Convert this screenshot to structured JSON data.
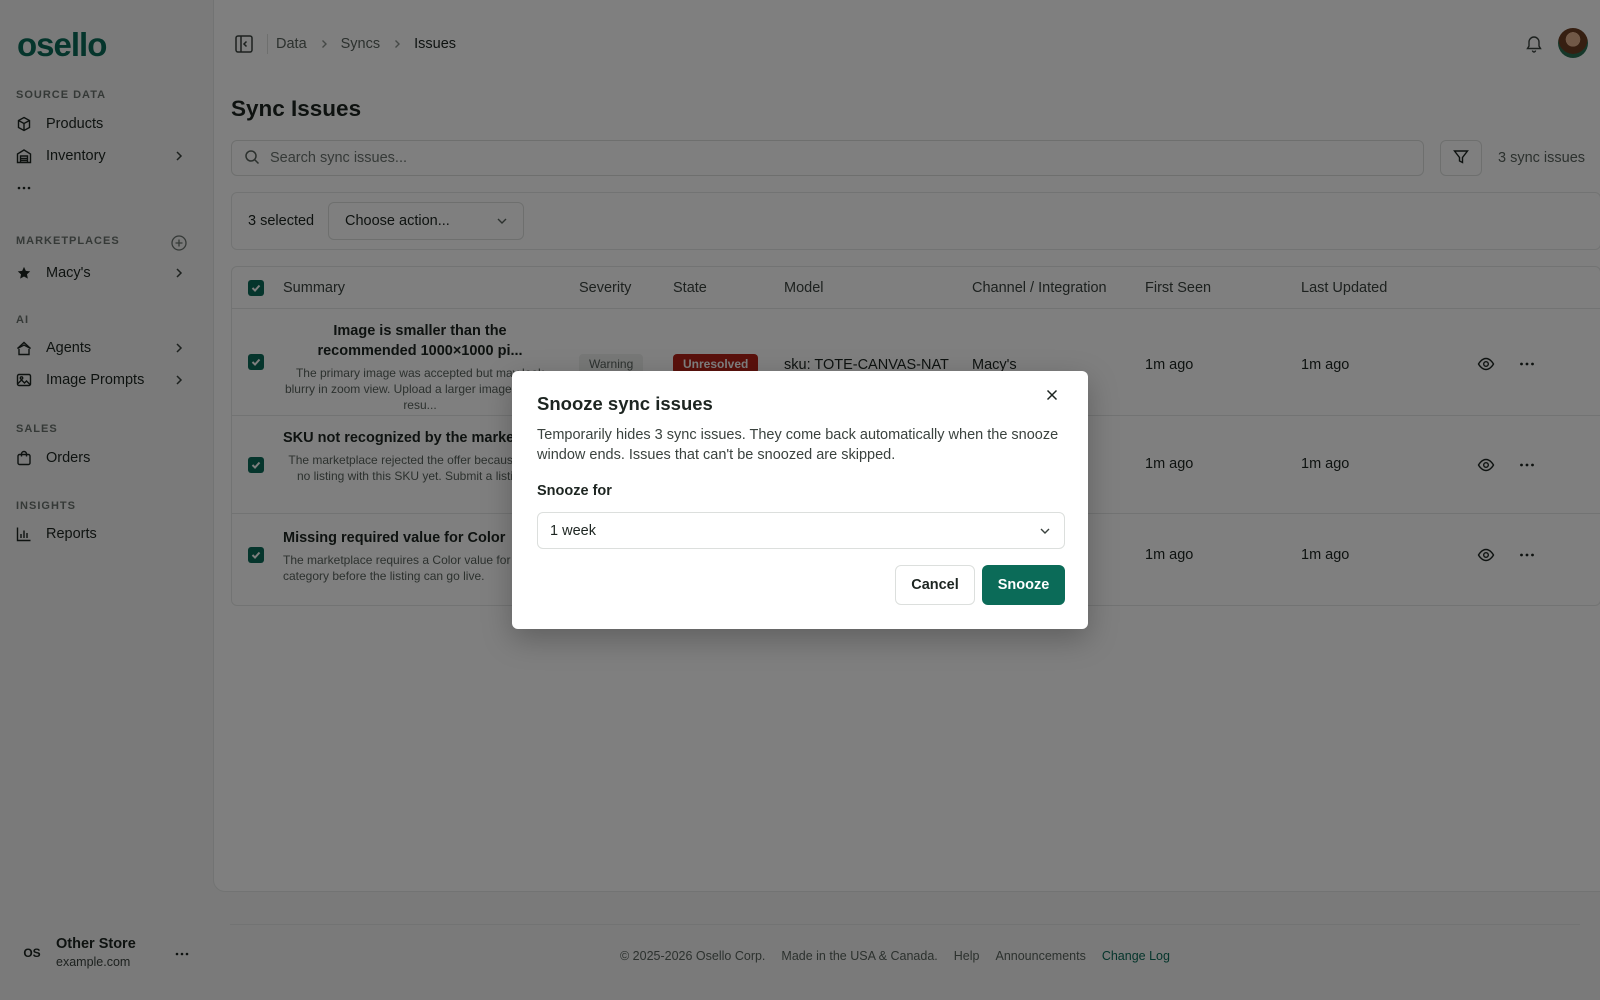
{
  "brand": {
    "logo": "osello",
    "accent": "#0b6b58"
  },
  "sidebar": {
    "sections": [
      {
        "label": "SOURCE DATA",
        "items": [
          {
            "label": "Products",
            "icon": "box-icon"
          },
          {
            "label": "Inventory",
            "icon": "warehouse-icon",
            "chevron": true
          }
        ]
      },
      {
        "label": "MARKETPLACES",
        "items": [
          {
            "label": "Macy's",
            "icon": "star-icon",
            "chevron": true
          }
        ]
      },
      {
        "label": "AI",
        "items": [
          {
            "label": "Agents",
            "icon": "agent-icon",
            "chevron": true
          },
          {
            "label": "Image Prompts",
            "icon": "image-icon",
            "chevron": true
          }
        ]
      },
      {
        "label": "SALES",
        "items": [
          {
            "label": "Orders",
            "icon": "bag-icon"
          }
        ]
      },
      {
        "label": "INSIGHTS",
        "items": [
          {
            "label": "Reports",
            "icon": "chart-icon"
          }
        ]
      }
    ],
    "store": {
      "initials": "OS",
      "name": "Other Store",
      "url": "example.com"
    }
  },
  "breadcrumb": [
    "Data",
    "Syncs",
    "Issues"
  ],
  "page": {
    "title": "Sync Issues",
    "search_placeholder": "Search sync issues...",
    "count": "3 sync issues",
    "selected": "3 selected",
    "bulk_action_placeholder": "Choose action..."
  },
  "table": {
    "columns": [
      "Summary",
      "Severity",
      "State",
      "Model",
      "Channel / Integration",
      "First Seen",
      "Last Updated"
    ],
    "rows": [
      {
        "title": "Image is smaller than the recommended 1000×1000 pi...",
        "desc": "The primary image was accepted but may look blurry in zoom view. Upload a larger image for best resu...",
        "severity": "Warning",
        "state": "Unresolved",
        "model": "sku: TOTE-CANVAS-NAT",
        "channel": "Macy's",
        "first_seen": "1m ago",
        "last_updated": "1m ago"
      },
      {
        "title": "SKU not recognized by the marketplace",
        "desc": "The marketplace rejected the offer because it has no listing with this SKU yet. Submit a listing f...",
        "severity": "",
        "state": "",
        "model": "",
        "channel": "",
        "first_seen": "1m ago",
        "last_updated": "1m ago"
      },
      {
        "title": "Missing required value for Color",
        "desc": "The marketplace requires a Color value for this category before the listing can go live.",
        "severity": "",
        "state": "",
        "model": "",
        "channel": "",
        "first_seen": "1m ago",
        "last_updated": "1m ago"
      }
    ]
  },
  "footer": {
    "copyright": "© 2025-2026 Osello Corp.",
    "made_in": "Made in the USA & Canada.",
    "links": [
      "Help",
      "Announcements",
      "Change Log"
    ]
  },
  "modal": {
    "title": "Snooze sync issues",
    "description": "Temporarily hides 3 sync issues. They come back automatically when the snooze window ends. Issues that can't be snoozed are skipped.",
    "field_label": "Snooze for",
    "selected_value": "1 week",
    "cancel_label": "Cancel",
    "confirm_label": "Snooze"
  }
}
